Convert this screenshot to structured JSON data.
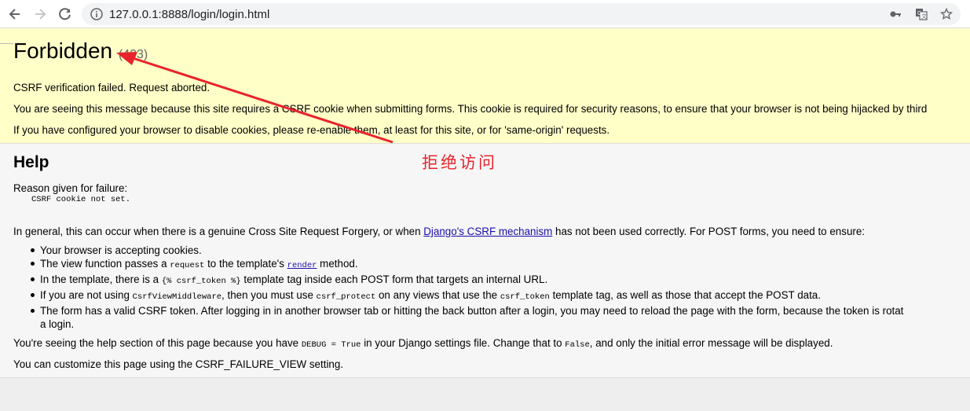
{
  "browser": {
    "url": "127.0.0.1:8888/login/login.html",
    "icons": [
      "back-arrow-icon",
      "forward-arrow-icon",
      "reload-icon",
      "info-icon",
      "key-icon",
      "translate-icon",
      "star-icon"
    ]
  },
  "summary": {
    "title": "Forbidden",
    "code": "(403)",
    "verification_failed": "CSRF verification failed. Request aborted.",
    "reason_text": "You are seeing this message because this site requires a CSRF cookie when submitting forms. This cookie is required for security reasons, to ensure that your browser is not being hijacked by third",
    "cookies_text": "If you have configured your browser to disable cookies, please re-enable them, at least for this site, or for 'same-origin' requests."
  },
  "help": {
    "heading": "Help",
    "reason_label": "Reason given for failure:",
    "reason_value": "CSRF cookie not set.",
    "general_pre": "In general, this can occur when there is a genuine Cross Site Request Forgery, or when ",
    "general_link": "Django's CSRF mechanism",
    "general_post": " has not been used correctly. For POST forms, you need to ensure:",
    "items": {
      "i1": "Your browser is accepting cookies.",
      "i2_pre": "The view function passes a ",
      "i2_code": "request",
      "i2_mid": " to the template's ",
      "i2_link": "render",
      "i2_post": " method.",
      "i3_pre": "In the template, there is a ",
      "i3_code": "{% csrf_token %}",
      "i3_post": " template tag inside each POST form that targets an internal URL.",
      "i4_pre": "If you are not using ",
      "i4_code1": "CsrfViewMiddleware",
      "i4_mid1": ", then you must use ",
      "i4_code2": "csrf_protect",
      "i4_mid2": " on any views that use the ",
      "i4_code3": "csrf_token",
      "i4_post": " template tag, as well as those that accept the POST data.",
      "i5_line1": "The form has a valid CSRF token. After logging in in another browser tab or hitting the back button after a login, you may need to reload the page with the form, because the token is rotat",
      "i5_line2": "a login."
    },
    "debug_pre": "You're seeing the help section of this page because you have ",
    "debug_code1": "DEBUG = True",
    "debug_mid": " in your Django settings file. Change that to ",
    "debug_code2": "False",
    "debug_post": ", and only the initial error message will be displayed.",
    "customize": "You can customize this page using the CSRF_FAILURE_VIEW setting."
  },
  "annotation": {
    "text": "拒绝访问",
    "color": "#e8232d"
  }
}
